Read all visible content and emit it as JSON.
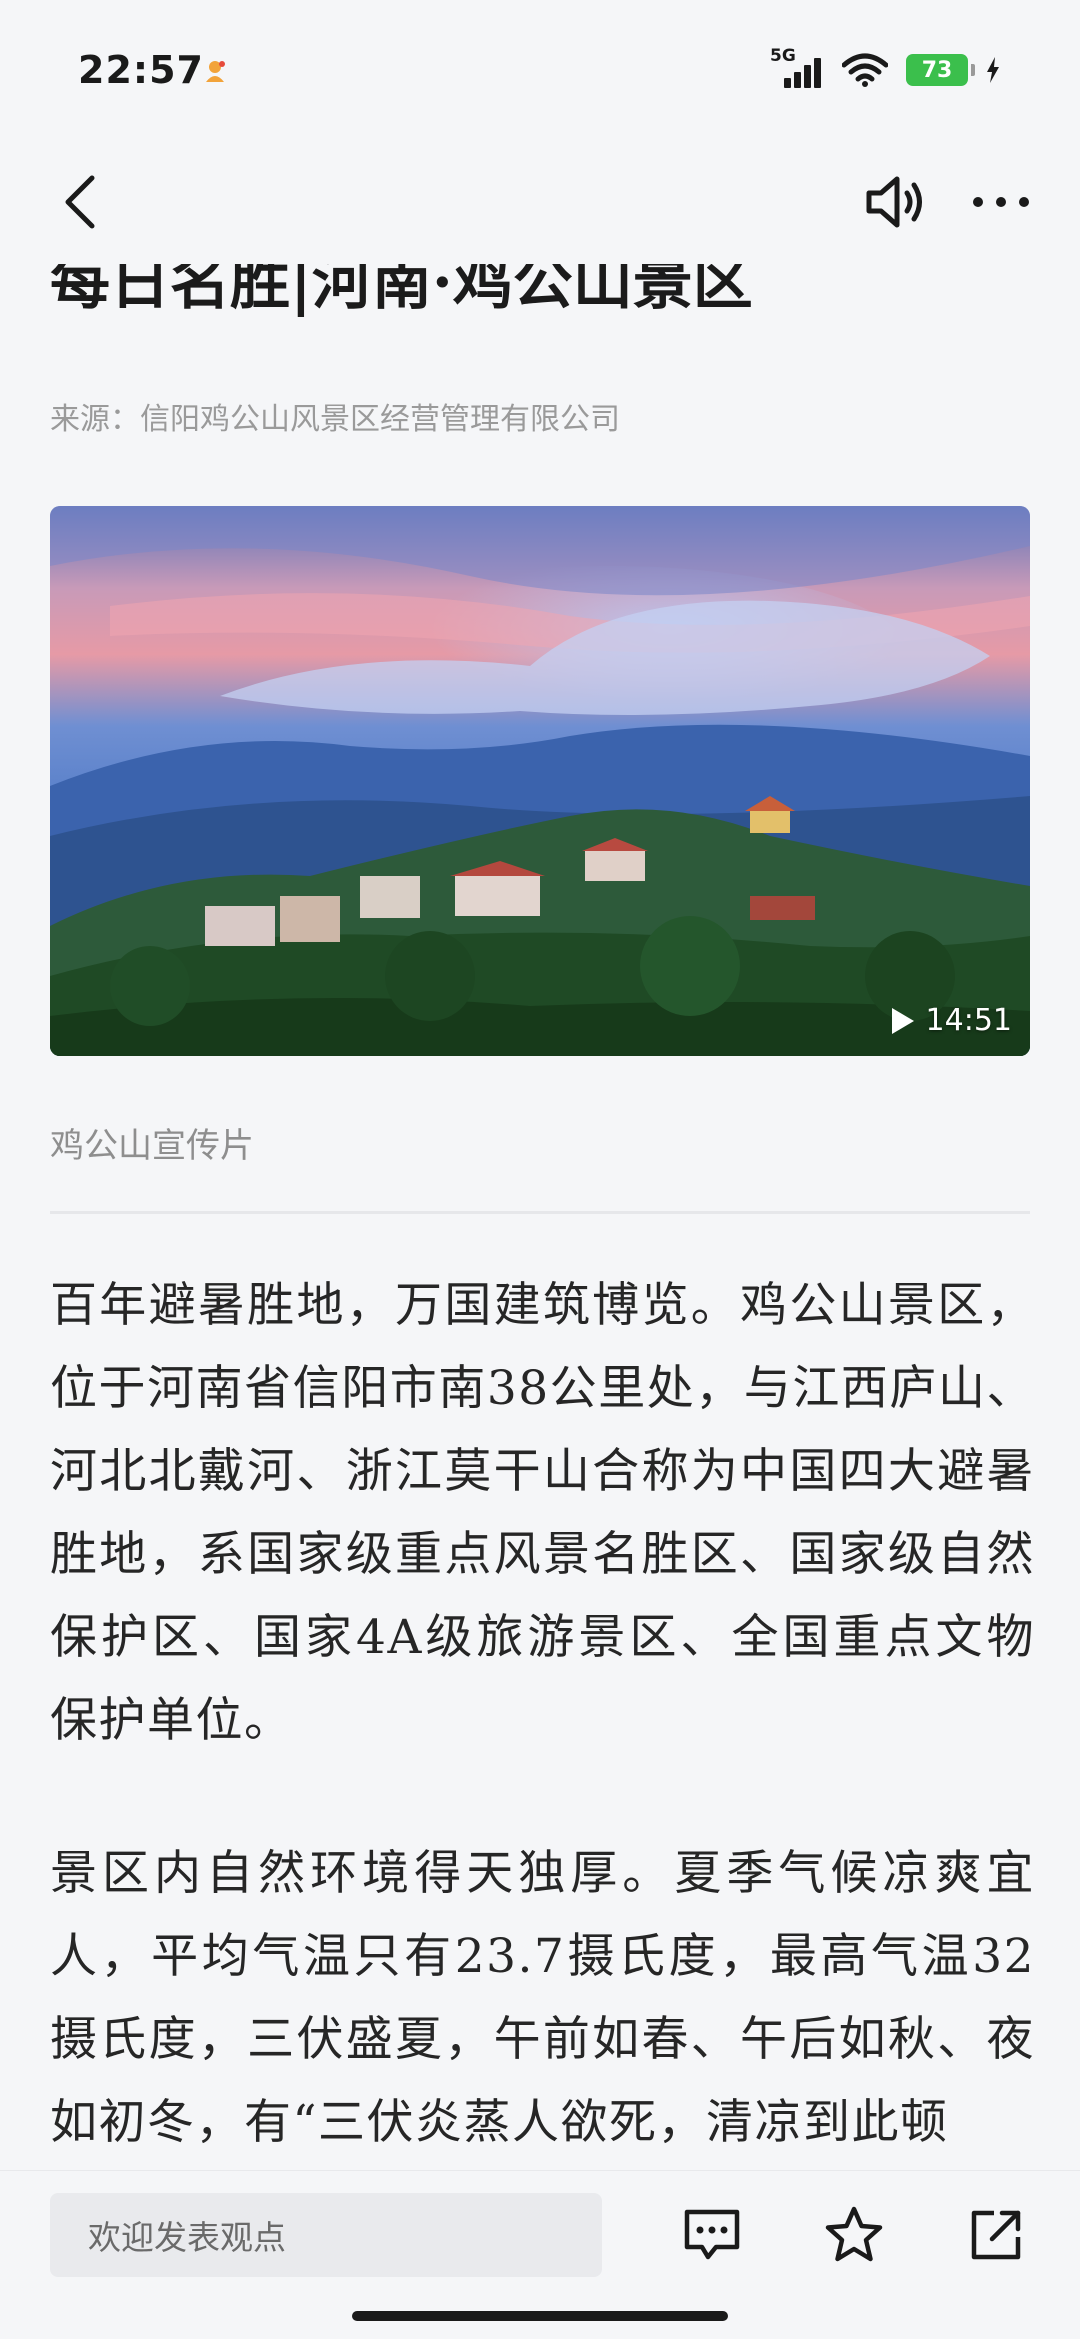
{
  "status_bar": {
    "time": "22:57",
    "network": "5G",
    "battery_level": "73",
    "icons": [
      "app-notification-icon",
      "signal-icon",
      "wifi-icon",
      "battery-icon",
      "charging-icon"
    ]
  },
  "nav": {
    "icons": [
      "back-arrow-icon",
      "speaker-icon",
      "more-dots-icon"
    ]
  },
  "article": {
    "title": "每日名胜|河南·鸡公山景区",
    "source": "来源：信阳鸡公山风景区经营管理有限公司",
    "video": {
      "duration": "14:51",
      "caption": "鸡公山宣传片"
    },
    "paragraphs": [
      "百年避暑胜地，万国建筑博览。鸡公山景区，位于河南省信阳市南38公里处，与江西庐山、河北北戴河、浙江莫干山合称为中国四大避暑胜地，系国家级重点风景名胜区、国家级自然保护区、国家4A级旅游景区、全国重点文物保护单位。",
      "景区内自然环境得天独厚。夏季气候凉爽宜人，平均气温只有23.7摄氏度，最高气温32摄氏度，三伏盛夏，午前如春、午后如秋、夜如初冬，有“三伏炎蒸人欲死，清凉到此顿"
    ]
  },
  "bottom_bar": {
    "comment_placeholder": "欢迎发表观点",
    "icons": [
      "comment-icon",
      "star-icon",
      "share-icon"
    ]
  },
  "colors": {
    "background": "#f5f6f8",
    "battery_green": "#3bbf4c",
    "text_primary": "#262626",
    "text_secondary": "#9a9a9a"
  }
}
